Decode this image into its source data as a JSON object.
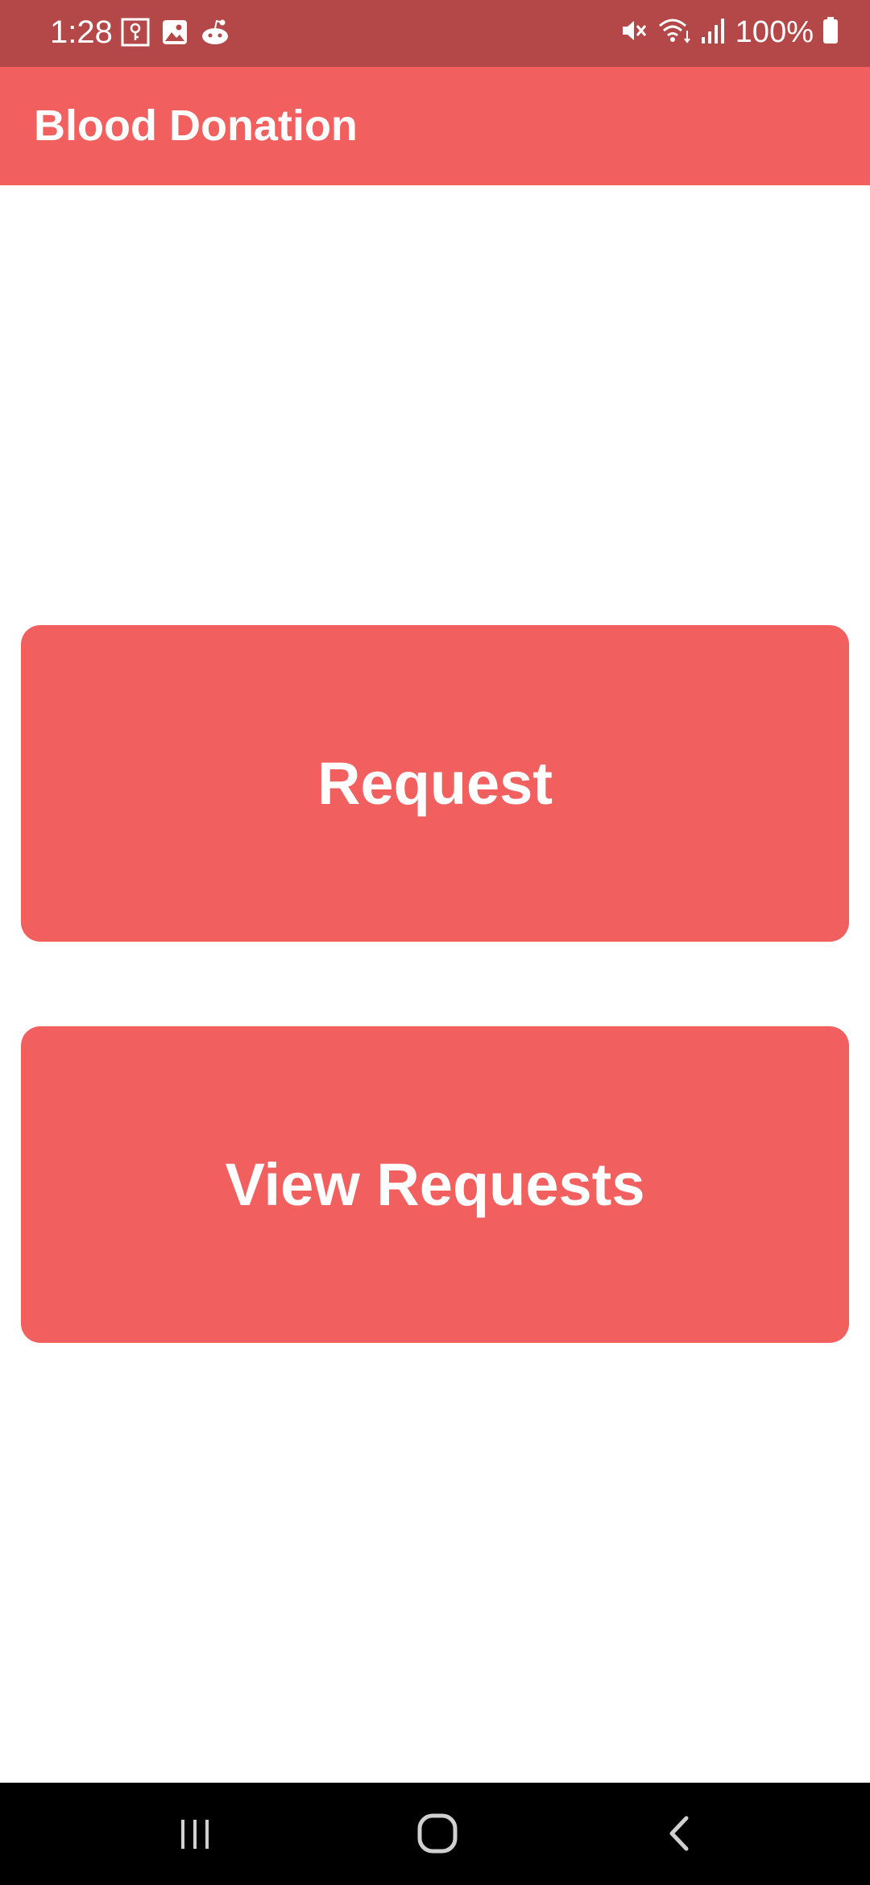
{
  "status_bar": {
    "time": "1:28",
    "battery": "100%",
    "icons": [
      "key-notification-icon",
      "image-notification-icon",
      "reddit-icon",
      "mute-icon",
      "wifi-icon",
      "signal-icon",
      "battery-icon"
    ]
  },
  "app_bar": {
    "title": "Blood Donation"
  },
  "main": {
    "request_label": "Request",
    "view_requests_label": "View Requests"
  },
  "nav_bar": {
    "icons": [
      "recent-apps-icon",
      "home-icon",
      "back-icon"
    ]
  },
  "colors": {
    "primary": "#f25f5f",
    "status_bar": "#b44848",
    "background": "#ffffff",
    "text_on_primary": "#ffffff",
    "nav_bar": "#000000"
  }
}
